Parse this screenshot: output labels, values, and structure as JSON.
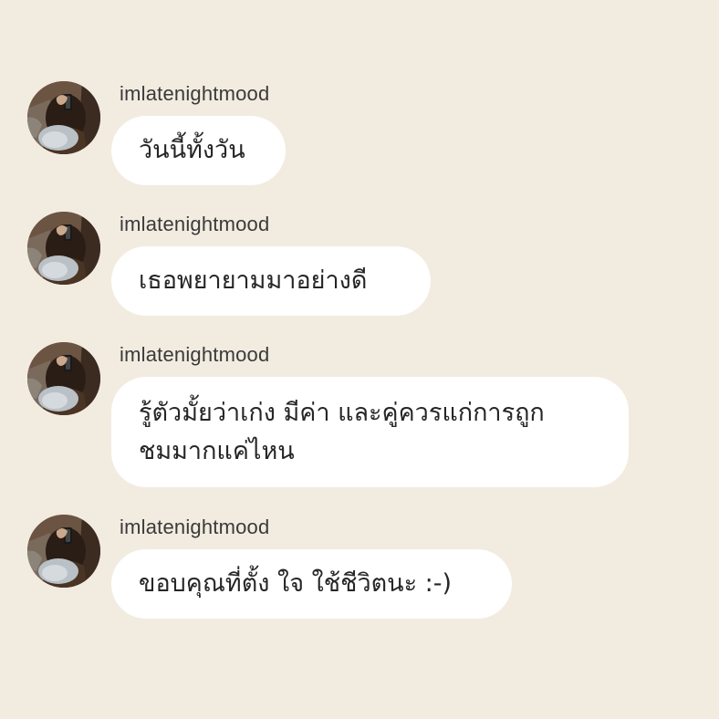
{
  "messages": [
    {
      "username": "imlatenightmood",
      "text": "วันนี้ทั้งวัน",
      "avatar_icon": "user-avatar-photo"
    },
    {
      "username": "imlatenightmood",
      "text": "เธอพยายามมาอย่างดี",
      "avatar_icon": "user-avatar-photo"
    },
    {
      "username": "imlatenightmood",
      "text": "รู้ตัวมั้ยว่าเก่ง มีค่า และคู่ควรแก่การถูก\nชมมากแค่ไหน",
      "avatar_icon": "user-avatar-photo"
    },
    {
      "username": "imlatenightmood",
      "text": "ขอบคุณที่ตั้ง ใจ ใช้ชีวิตนะ :-)",
      "avatar_icon": "user-avatar-photo"
    }
  ],
  "colors": {
    "background": "#f2ebe0",
    "bubble": "#ffffff",
    "text": "#262626",
    "username": "#3a3a3a"
  }
}
